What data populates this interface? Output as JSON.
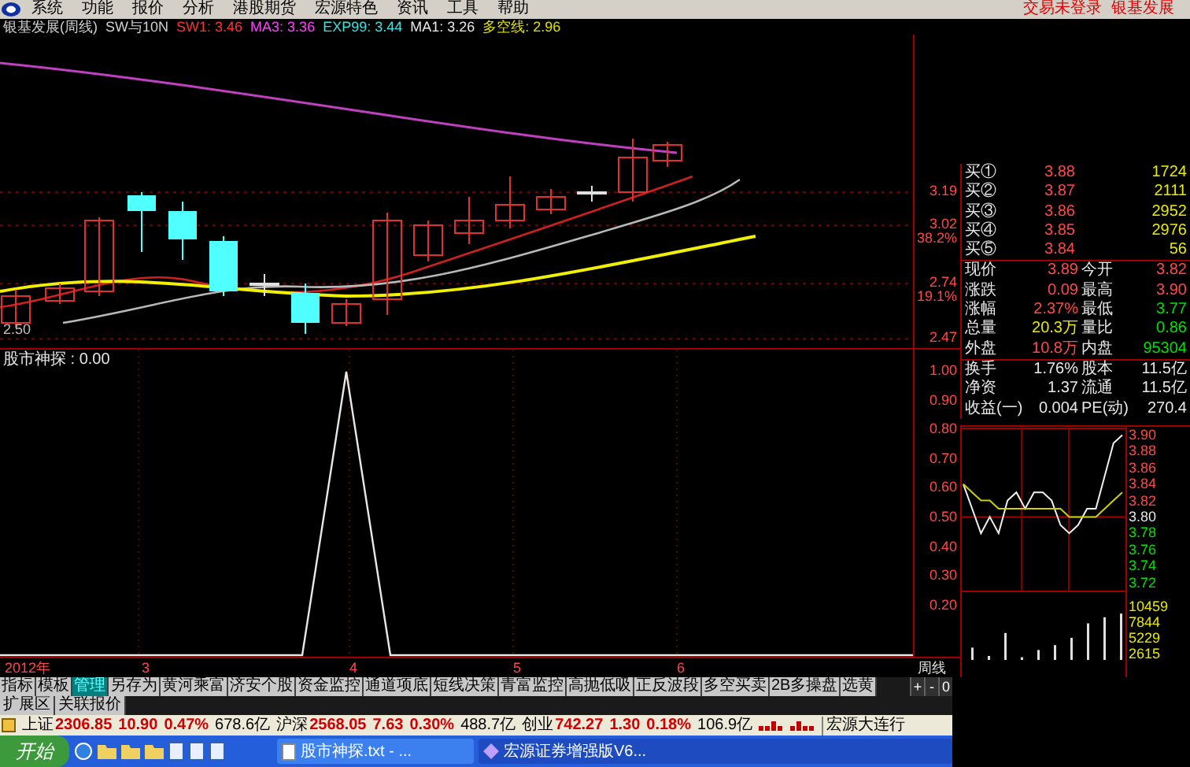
{
  "menu": {
    "items": [
      "系统",
      "功能",
      "报价",
      "分析",
      "港股期货",
      "宏源特色",
      "资讯",
      "工具",
      "帮助"
    ],
    "right": [
      "交易未登录",
      "银基发展"
    ]
  },
  "info": {
    "title": "银基发展(周线)",
    "formula": "SW与10N",
    "indicators": [
      {
        "label": "SW1:",
        "value": "3.46",
        "color": "#ff3030"
      },
      {
        "label": "MA3:",
        "value": "3.36",
        "color": "#ff40ff"
      },
      {
        "label": "EXP99:",
        "value": "3.44",
        "color": "#40e0e0"
      },
      {
        "label": "MA1:",
        "value": "3.26",
        "color": "#e8e8e8"
      },
      {
        "label": "多空线:",
        "value": "2.96",
        "color": "#e0e000"
      }
    ]
  },
  "main_chart": {
    "price_labels": [
      {
        "value": "3.19"
      },
      {
        "value": "3.02",
        "pct": "38.2%"
      },
      {
        "value": "2.74",
        "pct": "19.1%"
      },
      {
        "value": "2.47"
      }
    ],
    "low_marker": "2.50"
  },
  "indicator_panel": {
    "title": "股市神探 : 0.00",
    "axis": [
      "1.00",
      "0.90",
      "0.80",
      "0.70",
      "0.60",
      "0.50",
      "0.40",
      "0.30",
      "0.20"
    ]
  },
  "x_axis": {
    "labels": [
      "2012年",
      "3",
      "4",
      "5",
      "6"
    ],
    "period": "周线"
  },
  "quote": {
    "buy_rows": [
      {
        "label": "买①",
        "price": "3.88",
        "volume": "1724"
      },
      {
        "label": "买②",
        "price": "3.87",
        "volume": "2111"
      },
      {
        "label": "买③",
        "price": "3.86",
        "volume": "2952"
      },
      {
        "label": "买④",
        "price": "3.85",
        "volume": "2976"
      },
      {
        "label": "买⑤",
        "price": "3.84",
        "volume": "56"
      }
    ],
    "stats": [
      [
        {
          "label": "现价",
          "value": "3.89",
          "color": "#ff4848"
        },
        {
          "label": "今开",
          "value": "3.82",
          "color": "#ff4848"
        }
      ],
      [
        {
          "label": "涨跌",
          "value": "0.09",
          "color": "#ff4848"
        },
        {
          "label": "最高",
          "value": "3.90",
          "color": "#ff4848"
        }
      ],
      [
        {
          "label": "涨幅",
          "value": "2.37%",
          "color": "#ff4848"
        },
        {
          "label": "最低",
          "value": "3.77",
          "color": "#00e000"
        }
      ],
      [
        {
          "label": "总量",
          "value": "20.3万",
          "color": "#e8e800"
        },
        {
          "label": "量比",
          "value": "0.86",
          "color": "#00e000"
        }
      ],
      [
        {
          "label": "外盘",
          "value": "10.8万",
          "color": "#ff4848"
        },
        {
          "label": "内盘",
          "value": "95304",
          "color": "#00e000"
        }
      ],
      [
        {
          "label": "换手",
          "value": "1.76%",
          "color": "#e8e8e8"
        },
        {
          "label": "股本",
          "value": "11.5亿",
          "color": "#e8e8e8"
        }
      ],
      [
        {
          "label": "净资",
          "value": "1.37",
          "color": "#e8e8e8"
        },
        {
          "label": "流通",
          "value": "11.5亿",
          "color": "#e8e8e8"
        }
      ],
      [
        {
          "label": "收益(一)",
          "value": "0.004",
          "color": "#e8e8e8"
        },
        {
          "label": "PE(动)",
          "value": "270.4",
          "color": "#e8e8e8"
        }
      ]
    ]
  },
  "intraday": {
    "price_chart": {
      "chart_data": {
        "type": "line",
        "ylim": [
          3.71,
          3.91
        ],
        "yticks": [
          {
            "value": 3.9,
            "label": "3.90"
          },
          {
            "value": 3.88,
            "label": "3.88"
          },
          {
            "value": 3.86,
            "label": "3.86"
          },
          {
            "value": 3.84,
            "label": "3.84"
          },
          {
            "value": 3.82,
            "label": "3.82"
          },
          {
            "value": 3.8,
            "label": "3.80"
          },
          {
            "value": 3.78,
            "label": "3.78"
          },
          {
            "value": 3.76,
            "label": "3.76"
          },
          {
            "value": 3.74,
            "label": "3.74"
          },
          {
            "value": 3.72,
            "label": "3.72"
          }
        ],
        "ref_lines": [
          {
            "axis": "y",
            "value": 3.8,
            "color": "#a00000"
          }
        ],
        "series": [
          {
            "color": "#f0f0f0",
            "values": [
              3.84,
              3.81,
              3.78,
              3.8,
              3.78,
              3.82,
              3.83,
              3.81,
              3.83,
              3.83,
              3.82,
              3.79,
              3.78,
              3.79,
              3.81,
              3.81,
              3.85,
              3.89,
              3.9
            ]
          },
          {
            "color": "#d0d000",
            "values": [
              3.84,
              3.83,
              3.82,
              3.82,
              3.81,
              3.81,
              3.81,
              3.81,
              3.81,
              3.81,
              3.81,
              3.81,
              3.8,
              3.8,
              3.8,
              3.8,
              3.81,
              3.82,
              3.83
            ]
          }
        ]
      }
    },
    "volume_chart": {
      "chart_data": {
        "type": "bar",
        "ylim": [
          0,
          13000
        ],
        "yticks": [
          {
            "value": 10459,
            "label": "10459"
          },
          {
            "value": 7844,
            "label": "7844"
          },
          {
            "value": 5229,
            "label": "5229"
          },
          {
            "value": 2615,
            "label": "2615"
          }
        ],
        "values": [
          3600,
          2200,
          6000,
          2000,
          3200,
          4000,
          5200,
          7600,
          8600,
          9200
        ]
      }
    }
  },
  "toolbar": {
    "tabs": [
      {
        "label": "指标",
        "selected": false
      },
      {
        "label": "模板",
        "selected": false
      },
      {
        "label": "管理",
        "selected": true
      },
      {
        "label": "另存为",
        "selected": false
      },
      {
        "label": "黄河乘富",
        "selected": false
      },
      {
        "label": "济安个股",
        "selected": false
      },
      {
        "label": "资金监控",
        "selected": false
      },
      {
        "label": "通道项底",
        "selected": false
      },
      {
        "label": "短线决策",
        "selected": false
      },
      {
        "label": "青富监控",
        "selected": false
      },
      {
        "label": "高抛低吸",
        "selected": false
      },
      {
        "label": "正反波段",
        "selected": false
      },
      {
        "label": "多空买卖",
        "selected": false
      },
      {
        "label": "2B多操盘",
        "selected": false
      },
      {
        "label": "选黄",
        "selected": false
      }
    ],
    "buttons": [
      "+",
      "-",
      "0"
    ],
    "extra_tabs": [
      "扩展区",
      "关联报价"
    ]
  },
  "status_bar": {
    "indices": [
      {
        "name": "上证",
        "value": "2306.85",
        "change": "10.90",
        "pct": "0.47%",
        "amount": "678.6亿"
      },
      {
        "name": "沪深",
        "value": "2568.05",
        "change": "7.63",
        "pct": "0.30%",
        "amount": "488.7亿"
      },
      {
        "name": "创业",
        "value": "742.27",
        "change": "1.30",
        "pct": "0.18%",
        "amount": "106.9亿"
      }
    ],
    "ticker": "宏源大连行"
  },
  "taskbar": {
    "start": "开始",
    "tasks": [
      "股市神探.txt - ...",
      "宏源证券增强版V6..."
    ]
  }
}
